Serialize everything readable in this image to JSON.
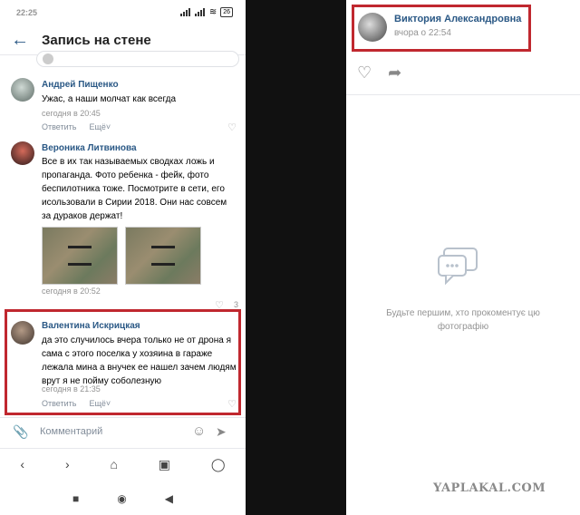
{
  "status_bar": {
    "time": "22:25",
    "battery": "26"
  },
  "header": {
    "title": "Запись на стене"
  },
  "comments": [
    {
      "author": "Андрей Пищенко",
      "text": "Ужас, а наши молчат как всегда",
      "time": "сегодня в 20:45",
      "reply": "Ответить",
      "more": "Ещё"
    },
    {
      "author": "Вероника Литвинова",
      "text": "Все в их так называемых сводках ложь и пропаганда. Фото ребенка - фейк, фото беспилотника тоже. Посмотрите в сети, его исользовали в Сирии 2018. Они нас совсем за дураков держат!",
      "time": "сегодня в 20:52",
      "likes": "3"
    },
    {
      "author": "Валентина Искрицкая",
      "text": "да это случилось вчера только не от дрона я сама с этого поселка у хозяина в гараже лежала мина а внучек ее нашел зачем людям врут я не пойму соболезную",
      "time": "сегодня в 21:35",
      "reply": "Ответить",
      "more": "Ещё"
    }
  ],
  "composer": {
    "placeholder": "Комментарий"
  },
  "right_panel": {
    "author": "Виктория Александровна",
    "time": "вчора о 22:54",
    "empty_text": "Будьте першим, хто прокоментує цю фотографію"
  },
  "watermark": "YAPLAKAL.COM",
  "colors": {
    "link": "#2a5885",
    "highlight": "#c0282f",
    "muted": "#939393"
  }
}
